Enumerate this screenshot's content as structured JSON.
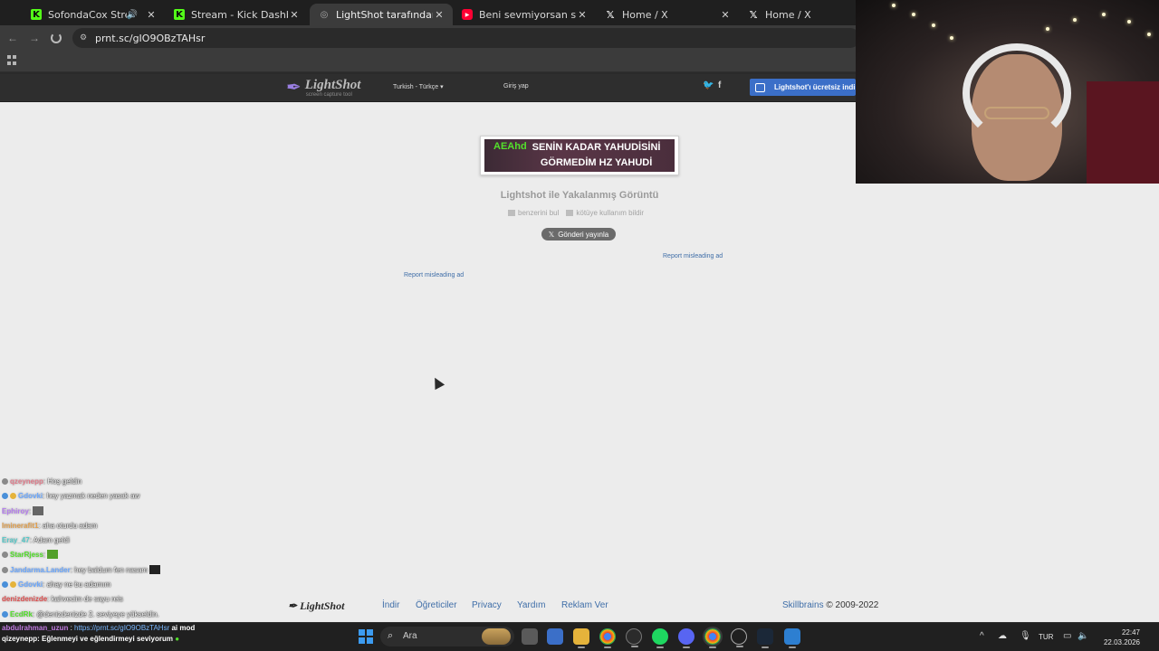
{
  "browser": {
    "tabs": [
      {
        "title": "SofondaCox Stream - Watc",
        "icon": "kick-icon",
        "audio": true
      },
      {
        "title": "Stream - Kick Dashboard",
        "icon": "kick-icon"
      },
      {
        "title": "LightShot tarafından Ekran Gör",
        "icon": "page-icon",
        "active": true
      },
      {
        "title": "Beni sevmiyorsan siktirgit başk",
        "icon": "youtube-icon"
      },
      {
        "title": "Home / X",
        "icon": "x-icon"
      },
      {
        "title": "Home / X",
        "icon": "x-icon"
      }
    ],
    "url": "prnt.sc/gIO9OBzTAHsr"
  },
  "site": {
    "logo_name": "LightShot",
    "logo_tagline": "screen capture tool",
    "language": "Turkish - Türkçe",
    "login": "Giriş yap",
    "download_button": "Lightshot'ı ücretsiz indi",
    "brand_color": "#3b6fc8"
  },
  "image": {
    "prefix": "AEAhd",
    "line1": "SENİN KADAR YAHUDİSİNİ",
    "line2": "GÖRMEDİM HZ YAHUDİ",
    "title": "Lightshot ile Yakalanmış Görüntü",
    "find_similar": "benzerini bul",
    "report_abuse": "kötüye kullanım bildir",
    "post_button": "Gönderi yayınla",
    "report_ad_right": "Report misleading ad",
    "report_ad_left": "Report misleading ad"
  },
  "footer": {
    "logo": "LightShot",
    "links": [
      "İndir",
      "Öğreticiler",
      "Privacy",
      "Yardım",
      "Reklam Ver"
    ],
    "company": "Skillbrains",
    "copyright": "© 2009-2022"
  },
  "chat": [
    {
      "user": "qzeynepp",
      "color": "#e07a8a",
      "text": ": Hoş geldin"
    },
    {
      "user": "Gdovki",
      "color": "#6aa7ff",
      "text": ": hey yazmak neden yasak aw"
    },
    {
      "user": "Ephiroy",
      "color": "#b57cf0",
      "text": ":"
    },
    {
      "user": "Iminerafit1",
      "color": "#e2a04e",
      "text": ": aha oturdu adam"
    },
    {
      "user": "Eray_47",
      "color": "#56c9c9",
      "text": ": Adam geldi"
    },
    {
      "user": "StarRjess",
      "color": "#53e02b",
      "text": ":"
    },
    {
      "user": "Jandarma.Lander",
      "color": "#6aa7ff",
      "text": ": hey baldum fen nasam"
    },
    {
      "user": "Gdovki",
      "color": "#6aa7ff",
      "text": ": ahay ne bu adamım"
    },
    {
      "user": "denizdenizde",
      "color": "#e05050",
      "text": ": kahvecim de sayu reis"
    },
    {
      "user": "EcdRk",
      "color": "#53e02b",
      "text": ": @denizdenizde 2. seviyeye yükseldin."
    }
  ],
  "chat_last": {
    "line1_user": "abdulrahman_uzun",
    "line1_link": "https://prnt.sc/gIO9OBzTAHsr",
    "line1_suffix": "ai mod",
    "line2_user": "qizeynepp",
    "line2_text": ": Eğlenmeyi ve eğlendirmeyi seviyorum"
  },
  "taskbar": {
    "search": "Ara",
    "lang": "TUR",
    "time": "22:47",
    "date": "22.03.2026"
  }
}
